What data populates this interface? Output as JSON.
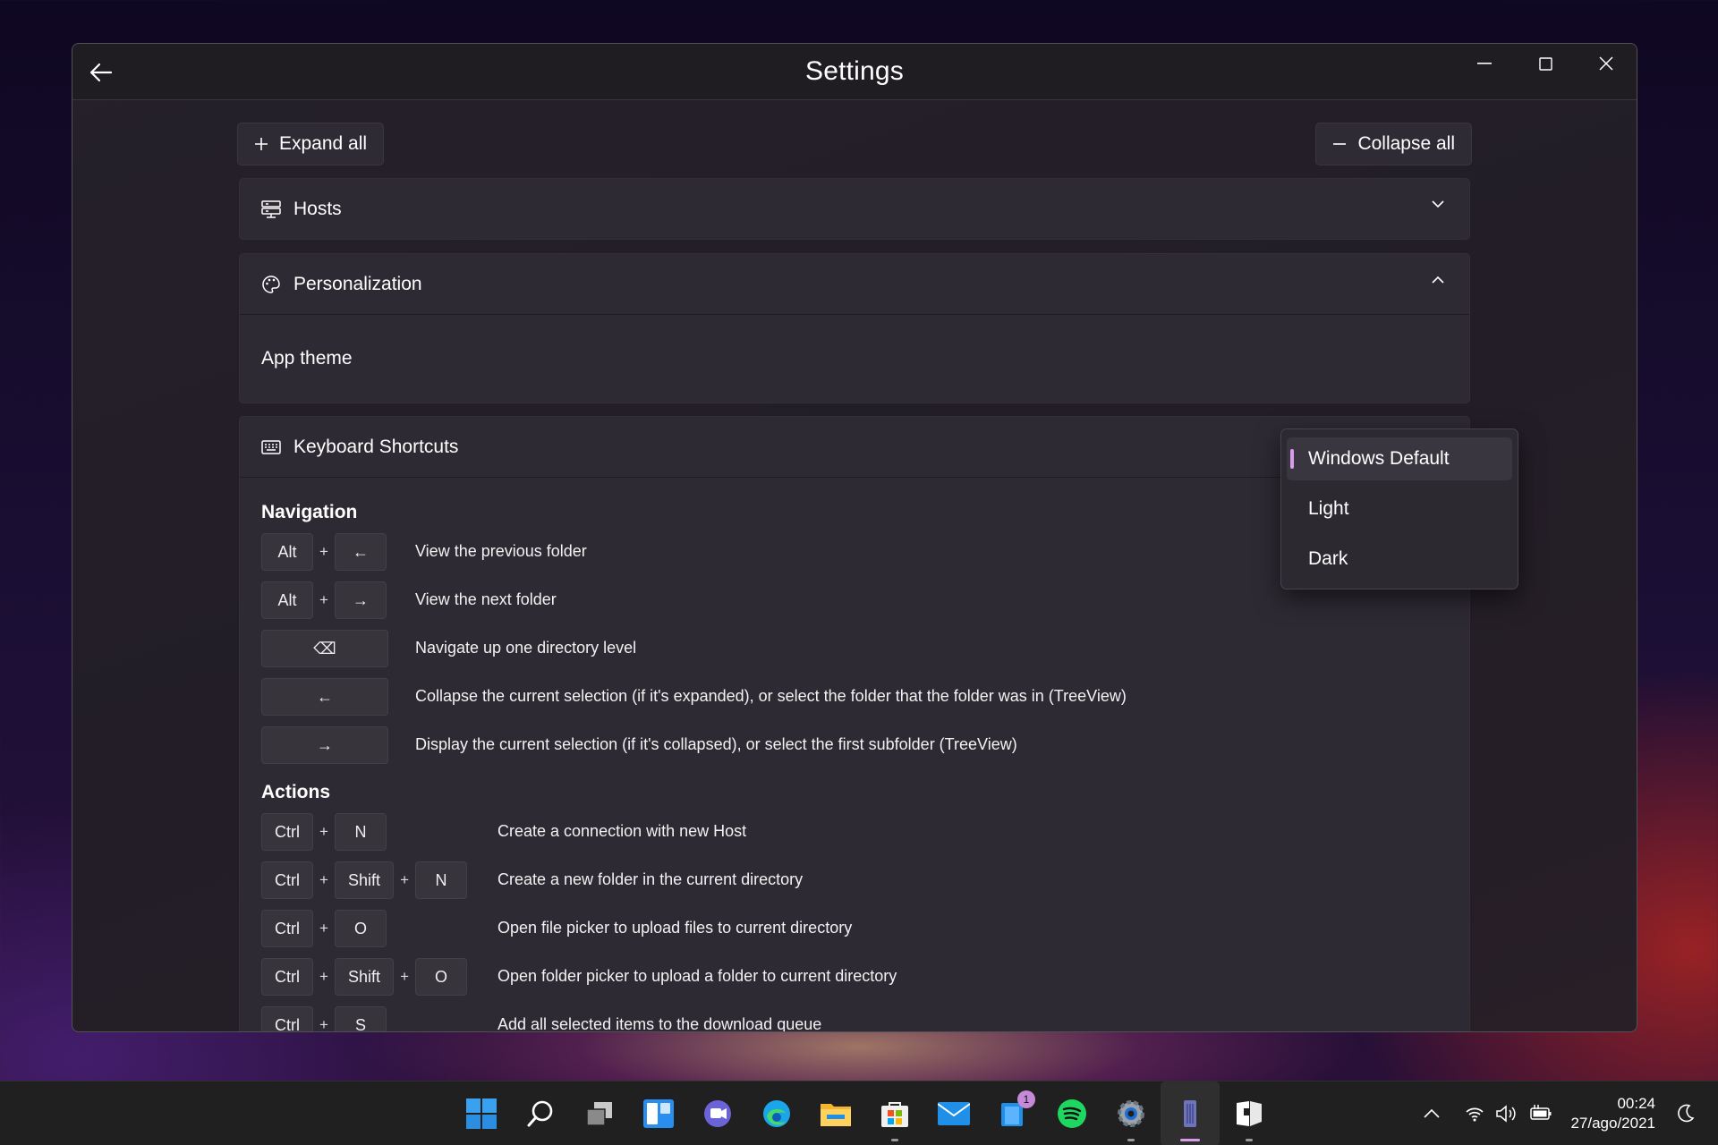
{
  "window": {
    "title": "Settings"
  },
  "toolbar": {
    "expand_label": "Expand all",
    "collapse_label": "Collapse all"
  },
  "sections": {
    "hosts": {
      "label": "Hosts"
    },
    "personalization": {
      "label": "Personalization",
      "app_theme_label": "App theme"
    },
    "keyboard": {
      "label": "Keyboard Shortcuts"
    }
  },
  "theme_dropdown": {
    "options": [
      "Windows Default",
      "Light",
      "Dark"
    ],
    "selected": "Windows Default"
  },
  "navigation": {
    "title": "Navigation",
    "shortcuts": [
      {
        "keys": [
          "Alt",
          "←"
        ],
        "desc": "View the previous folder"
      },
      {
        "keys": [
          "Alt",
          "→"
        ],
        "desc": "View the next folder"
      },
      {
        "keys": [
          "⌫"
        ],
        "desc": "Navigate up one directory level"
      },
      {
        "keys": [
          "←"
        ],
        "desc": "Collapse the current selection (if it's expanded), or select the folder that the folder was in (TreeView)"
      },
      {
        "keys": [
          "→"
        ],
        "desc": "Display the current selection (if it's collapsed), or select the first subfolder (TreeView)"
      }
    ]
  },
  "actions": {
    "title": "Actions",
    "plus": "+",
    "shortcuts": [
      {
        "keys": [
          "Ctrl",
          "N"
        ],
        "desc": "Create a connection with new Host"
      },
      {
        "keys": [
          "Ctrl",
          "Shift",
          "N"
        ],
        "desc": "Create a new folder in the current directory"
      },
      {
        "keys": [
          "Ctrl",
          "O"
        ],
        "desc": "Open file picker to upload files to current directory"
      },
      {
        "keys": [
          "Ctrl",
          "Shift",
          "O"
        ],
        "desc": "Open folder picker to upload a folder to current directory"
      },
      {
        "keys": [
          "Ctrl",
          "S"
        ],
        "desc": "Add all selected items to the download queue"
      }
    ]
  },
  "taskbar": {
    "apps": [
      "start-icon",
      "search-icon",
      "task-view-icon",
      "widgets-icon",
      "chat-icon",
      "edge-icon",
      "file-explorer-icon",
      "store-icon",
      "mail-icon",
      "todo-icon",
      "spotify-icon",
      "settings-icon",
      "ftp-app-icon",
      "notes-icon"
    ],
    "notification_badge": "1",
    "time": "00:24",
    "date": "27/ago/2021"
  },
  "colors": {
    "accent": "#d79de9",
    "window_bg": "#25202a",
    "card_bg": "#2e2a33"
  }
}
